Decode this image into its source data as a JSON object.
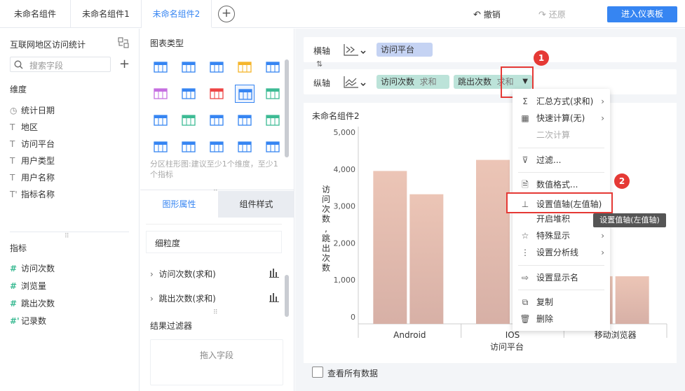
{
  "tabs": [
    "未命名组件",
    "未命名组件1",
    "未命名组件2"
  ],
  "toolbar": {
    "undo_label": "撤销",
    "redo_label": "还原",
    "enter_label": "进入仪表板"
  },
  "left": {
    "dataset_title": "互联网地区访问统计",
    "search_placeholder": "搜索字段",
    "dimension_title": "维度",
    "dimensions": [
      {
        "icon": "clock-icon",
        "label": "统计日期"
      },
      {
        "icon": "text-icon",
        "label": "地区"
      },
      {
        "icon": "text-icon",
        "label": "访问平台"
      },
      {
        "icon": "text-icon",
        "label": "用户类型"
      },
      {
        "icon": "text-icon",
        "label": "用户名称"
      },
      {
        "icon": "text-icon",
        "label": "指标名称"
      }
    ],
    "metric_title": "指标",
    "metrics": [
      {
        "label": "访问次数"
      },
      {
        "label": "浏览量"
      },
      {
        "label": "跳出次数"
      },
      {
        "label": "记录数"
      }
    ]
  },
  "mid": {
    "chart_type_title": "图表类型",
    "chart_hint": "分区柱形图:建议至少1个维度，至少1个指标",
    "tab_props": "图形属性",
    "tab_style": "组件样式",
    "granularity": "细粒度",
    "field1": "访问次数(求和)",
    "field2": "跳出次数(求和)",
    "filter_title": "结果过滤器",
    "drop_hint": "拖入字段"
  },
  "axis": {
    "x_label": "横轴",
    "x_pill": "访问平台",
    "y_label": "纵轴",
    "y_pill1_name": "访问次数",
    "y_pill1_agg": "求和",
    "y_pill2_name": "跳出次数",
    "y_pill2_agg": "求和"
  },
  "chart_title": "未命名组件2",
  "show_all": "查看所有数据",
  "menu": {
    "items": [
      "汇总方式(求和)",
      "快速计算(无)",
      "二次计算",
      "过滤...",
      "数值格式...",
      "设置值轴(左值轴)",
      "开启堆积",
      "特殊显示",
      "设置分析线",
      "设置显示名",
      "复制",
      "删除"
    ]
  },
  "tooltip": "设置值轴(左值轴)",
  "badges": [
    "1",
    "2"
  ],
  "colors": {
    "accent": "#3685f2",
    "bar_top": "#ecc5b6",
    "bar_bottom": "#d7b0a6",
    "badge": "#e53935"
  },
  "chart_data": {
    "type": "bar",
    "title": "未命名组件2",
    "xlabel": "访问平台",
    "ylabel": "访问次数,跳出次数",
    "categories": [
      "Android",
      "IOS",
      "移动浏览器"
    ],
    "series": [
      {
        "name": "访问次数",
        "values": [
          3950,
          4250,
          1100
        ]
      },
      {
        "name": "跳出次数",
        "values": [
          3320,
          3350,
          1100
        ]
      }
    ],
    "ylim": [
      0,
      5000
    ],
    "yticks": [
      "0",
      "1,000",
      "2,000",
      "3,000",
      "4,000",
      "5,000"
    ]
  }
}
